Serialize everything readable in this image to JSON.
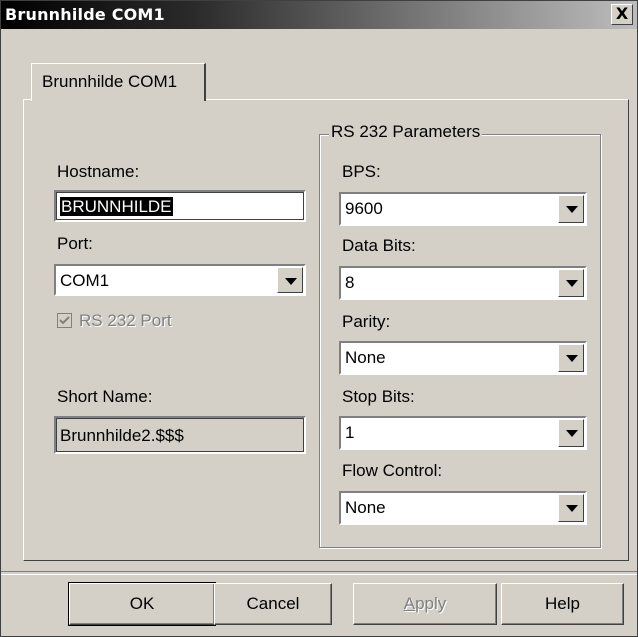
{
  "window": {
    "title": "Brunnhilde COM1",
    "close_glyph": "X"
  },
  "tab": {
    "label": "Brunnhilde COM1"
  },
  "left": {
    "hostname_label": "Hostname:",
    "hostname_value": "BRUNNHILDE",
    "port_label": "Port:",
    "port_value": "COM1",
    "rs232_checkbox_label": "RS 232 Port",
    "rs232_checked": true,
    "short_name_label": "Short Name:",
    "short_name_value": "Brunnhilde2.$$$"
  },
  "rs232": {
    "group_title": "RS 232 Parameters",
    "bps_label": "BPS:",
    "bps_value": "9600",
    "data_bits_label": "Data Bits:",
    "data_bits_value": "8",
    "parity_label": "Parity:",
    "parity_value": "None",
    "stop_bits_label": "Stop Bits:",
    "stop_bits_value": "1",
    "flow_control_label": "Flow Control:",
    "flow_control_value": "None"
  },
  "buttons": {
    "ok": "OK",
    "cancel": "Cancel",
    "apply_mnemonic": "A",
    "apply_rest": "pply",
    "help": "Help"
  },
  "colors": {
    "face": "#d4d0c8",
    "shadow": "#808080",
    "highlight": "#ffffff"
  }
}
